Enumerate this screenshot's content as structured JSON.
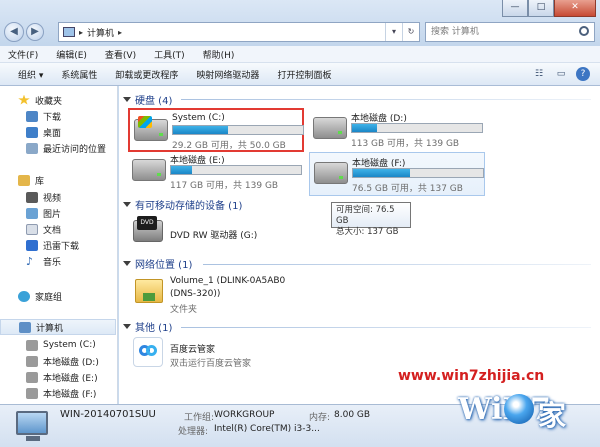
{
  "titlebar": {
    "window_buttons": [
      "—",
      "□",
      "✕"
    ],
    "address_path": "计算机",
    "search_placeholder": "搜索 计算机"
  },
  "menu": [
    "文件(F)",
    "编辑(E)",
    "查看(V)",
    "工具(T)",
    "帮助(H)"
  ],
  "toolbar": [
    "组织 ▾",
    "系统属性",
    "卸载或更改程序",
    "映射网络驱动器",
    "打开控制面板"
  ],
  "sidebar": {
    "favorites": {
      "title": "收藏夹",
      "items": [
        "下载",
        "桌面",
        "最近访问的位置"
      ]
    },
    "libraries": {
      "title": "库",
      "items": [
        "视频",
        "图片",
        "文档",
        "迅雷下载",
        "音乐"
      ]
    },
    "homegroup": "家庭组",
    "computer": {
      "title": "计算机",
      "items": [
        "System (C:)",
        "本地磁盘 (D:)",
        "本地磁盘 (E:)",
        "本地磁盘 (F:)"
      ]
    }
  },
  "groups": {
    "hard_disks": "硬盘 (4)",
    "removable": "有可移动存储的设备 (1)",
    "network": "网络位置 (1)",
    "other": "其他 (1)"
  },
  "drives": [
    {
      "name": "System (C:)",
      "size_text": "29.2 GB 可用，共 50.0 GB",
      "used_fraction": 0.42
    },
    {
      "name": "本地磁盘 (D:)",
      "size_text": "113 GB 可用，共 139 GB",
      "used_fraction": 0.19
    },
    {
      "name": "本地磁盘 (E:)",
      "size_text": "117 GB 可用，共 139 GB",
      "used_fraction": 0.16
    },
    {
      "name": "本地磁盘 (F:)",
      "size_text": "76.5 GB 可用，共 137 GB",
      "used_fraction": 0.44
    }
  ],
  "tooltip": {
    "free": "可用空间: 76.5 GB",
    "total": "总大小: 137 GB"
  },
  "dvd": {
    "name": "DVD RW 驱动器 (G:)",
    "badge": "DVD"
  },
  "network_item": {
    "name_line1": "Volume_1 (DLINK-0A5AB0",
    "name_line2": "(DNS-320))",
    "type": "文件夹"
  },
  "other_item": {
    "name": "百度云管家",
    "desc": "双击运行百度云管家"
  },
  "status": {
    "computer_name": "WIN-20140701SUU",
    "workgroup_label": "工作组:",
    "workgroup": "WORKGROUP",
    "memory_label": "内存:",
    "memory": "8.00 GB",
    "cpu_label": "处理器:",
    "cpu": "Intel(R) Core(TM) i3-3..."
  },
  "watermark": {
    "url": "www.win7zhijia.cn",
    "logo": "WiN7",
    "logo_suffix": "家"
  }
}
